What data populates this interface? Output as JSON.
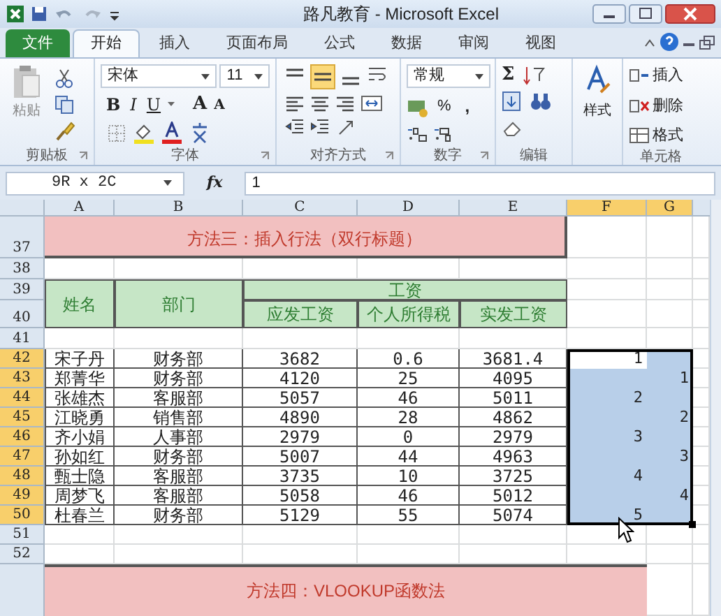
{
  "window": {
    "title": "路凡教育 - Microsoft Excel"
  },
  "ribbon_tabs": [
    {
      "label": "文件",
      "kind": "file",
      "selected": false
    },
    {
      "label": "开始",
      "kind": "tab",
      "selected": true
    },
    {
      "label": "插入",
      "kind": "tab",
      "selected": false
    },
    {
      "label": "页面布局",
      "kind": "tab",
      "selected": false
    },
    {
      "label": "公式",
      "kind": "tab",
      "selected": false
    },
    {
      "label": "数据",
      "kind": "tab",
      "selected": false
    },
    {
      "label": "审阅",
      "kind": "tab",
      "selected": false
    },
    {
      "label": "视图",
      "kind": "tab",
      "selected": false
    }
  ],
  "ribbon": {
    "clipboard": {
      "paste": "粘贴",
      "label": "剪贴板"
    },
    "font": {
      "name": "宋体",
      "size": "11",
      "bold": "B",
      "italic": "I",
      "underline": "U",
      "grow": "A",
      "shrink": "A",
      "label": "字体"
    },
    "alignment": {
      "vertical": [
        {
          "selected": false
        },
        {
          "selected": true
        },
        {
          "selected": false
        }
      ],
      "label": "对齐方式"
    },
    "number": {
      "format": "常规",
      "percent": "%",
      "comma": ",",
      "label": "数字"
    },
    "editing": {
      "sum": "Σ",
      "label": "编辑"
    },
    "styles": {
      "label": "样式"
    },
    "cells": {
      "insert": "插入",
      "delete": "删除",
      "format": "格式",
      "label": "单元格"
    }
  },
  "formula_bar": {
    "name_box": "9R x 2C",
    "function_label": "fx",
    "value": "1"
  },
  "sheet": {
    "columns": [
      {
        "label": "A",
        "selected": false
      },
      {
        "label": "B",
        "selected": false
      },
      {
        "label": "C",
        "selected": false
      },
      {
        "label": "D",
        "selected": false
      },
      {
        "label": "E",
        "selected": false
      },
      {
        "label": "F",
        "selected": true
      },
      {
        "label": "G",
        "selected": true
      }
    ],
    "rows": [
      {
        "label": "37",
        "selected": false
      },
      {
        "label": "38",
        "selected": false
      },
      {
        "label": "39",
        "selected": false
      },
      {
        "label": "40",
        "selected": false
      },
      {
        "label": "41",
        "selected": false
      },
      {
        "label": "42",
        "selected": true
      },
      {
        "label": "43",
        "selected": true
      },
      {
        "label": "44",
        "selected": true
      },
      {
        "label": "45",
        "selected": true
      },
      {
        "label": "46",
        "selected": true
      },
      {
        "label": "47",
        "selected": true
      },
      {
        "label": "48",
        "selected": true
      },
      {
        "label": "49",
        "selected": true
      },
      {
        "label": "50",
        "selected": true
      },
      {
        "label": "51",
        "selected": false
      },
      {
        "label": "52",
        "selected": false
      }
    ],
    "title": "方法三：插入行法（双行标题）",
    "header": {
      "name": "姓名",
      "department": "部门",
      "group": "工资",
      "sub": [
        "应发工资",
        "个人所得税",
        "实发工资"
      ]
    },
    "records": [
      {
        "name": "宋子丹",
        "department": "财务部",
        "gross": "3682",
        "tax": "0.6",
        "net": "3681.4",
        "f": {
          "value": "1",
          "selected": true,
          "active": true
        },
        "g": {
          "selected": true,
          "active": false
        }
      },
      {
        "name": "郑菁华",
        "department": "财务部",
        "gross": "4120",
        "tax": "25",
        "net": "4095",
        "f": {
          "selected": true,
          "active": false
        },
        "g": {
          "value": "1",
          "selected": true,
          "active": false
        }
      },
      {
        "name": "张雄杰",
        "department": "客服部",
        "gross": "5057",
        "tax": "46",
        "net": "5011",
        "f": {
          "value": "2",
          "selected": true,
          "active": false
        },
        "g": {
          "selected": true,
          "active": false
        }
      },
      {
        "name": "江晓勇",
        "department": "销售部",
        "gross": "4890",
        "tax": "28",
        "net": "4862",
        "f": {
          "selected": true,
          "active": false
        },
        "g": {
          "value": "2",
          "selected": true,
          "active": false
        }
      },
      {
        "name": "齐小娟",
        "department": "人事部",
        "gross": "2979",
        "tax": "0",
        "net": "2979",
        "f": {
          "value": "3",
          "selected": true,
          "active": false
        },
        "g": {
          "selected": true,
          "active": false
        }
      },
      {
        "name": "孙如红",
        "department": "财务部",
        "gross": "5007",
        "tax": "44",
        "net": "4963",
        "f": {
          "selected": true,
          "active": false
        },
        "g": {
          "value": "3",
          "selected": true,
          "active": false
        }
      },
      {
        "name": "甄士隐",
        "department": "客服部",
        "gross": "3735",
        "tax": "10",
        "net": "3725",
        "f": {
          "value": "4",
          "selected": true,
          "active": false
        },
        "g": {
          "selected": true,
          "active": false
        }
      },
      {
        "name": "周梦飞",
        "department": "客服部",
        "gross": "5058",
        "tax": "46",
        "net": "5012",
        "f": {
          "selected": true,
          "active": false
        },
        "g": {
          "value": "4",
          "selected": true,
          "active": false
        }
      },
      {
        "name": "杜春兰",
        "department": "财务部",
        "gross": "5129",
        "tax": "55",
        "net": "5074",
        "f": {
          "value": "5",
          "selected": true,
          "active": false
        },
        "g": {
          "selected": true,
          "active": false
        }
      }
    ],
    "title_2": "方法四：VLOOKUP函数法"
  }
}
